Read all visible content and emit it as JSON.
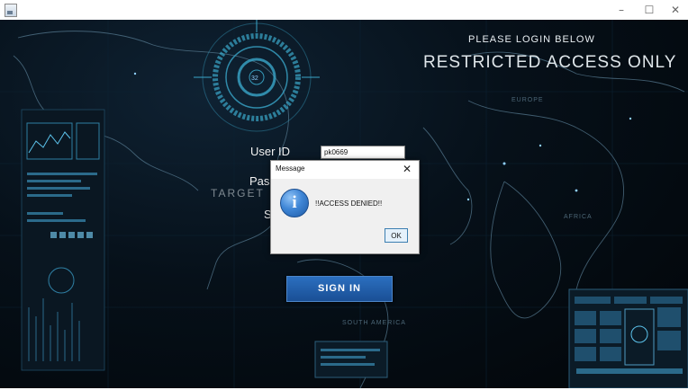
{
  "window": {
    "minimize_glyph": "–",
    "maximize_glyph": "☐",
    "close_glyph": "✕"
  },
  "header": {
    "please_login": "PLEASE LOGIN BELOW",
    "restricted": "RESTRICTED ACCESS ONLY"
  },
  "map_labels": {
    "europe": "EUROPE",
    "africa": "AFRICA",
    "south_america": "SOUTH AMERICA"
  },
  "form": {
    "user_id_label": "User ID",
    "user_id_value": "pk0669",
    "password_label": "Pass",
    "target_label": "TARGET",
    "third_label": "S",
    "signin_label": "SIGN IN"
  },
  "hud": {
    "dial_number": "32"
  },
  "dialog": {
    "title": "Message",
    "close_glyph": "✕",
    "icon_glyph": "i",
    "message": "!!ACCESS DENIED!!",
    "ok_label": "OK"
  },
  "colors": {
    "background": "#03080c",
    "accent": "#2b6fbf",
    "map": "#5a7f96"
  }
}
